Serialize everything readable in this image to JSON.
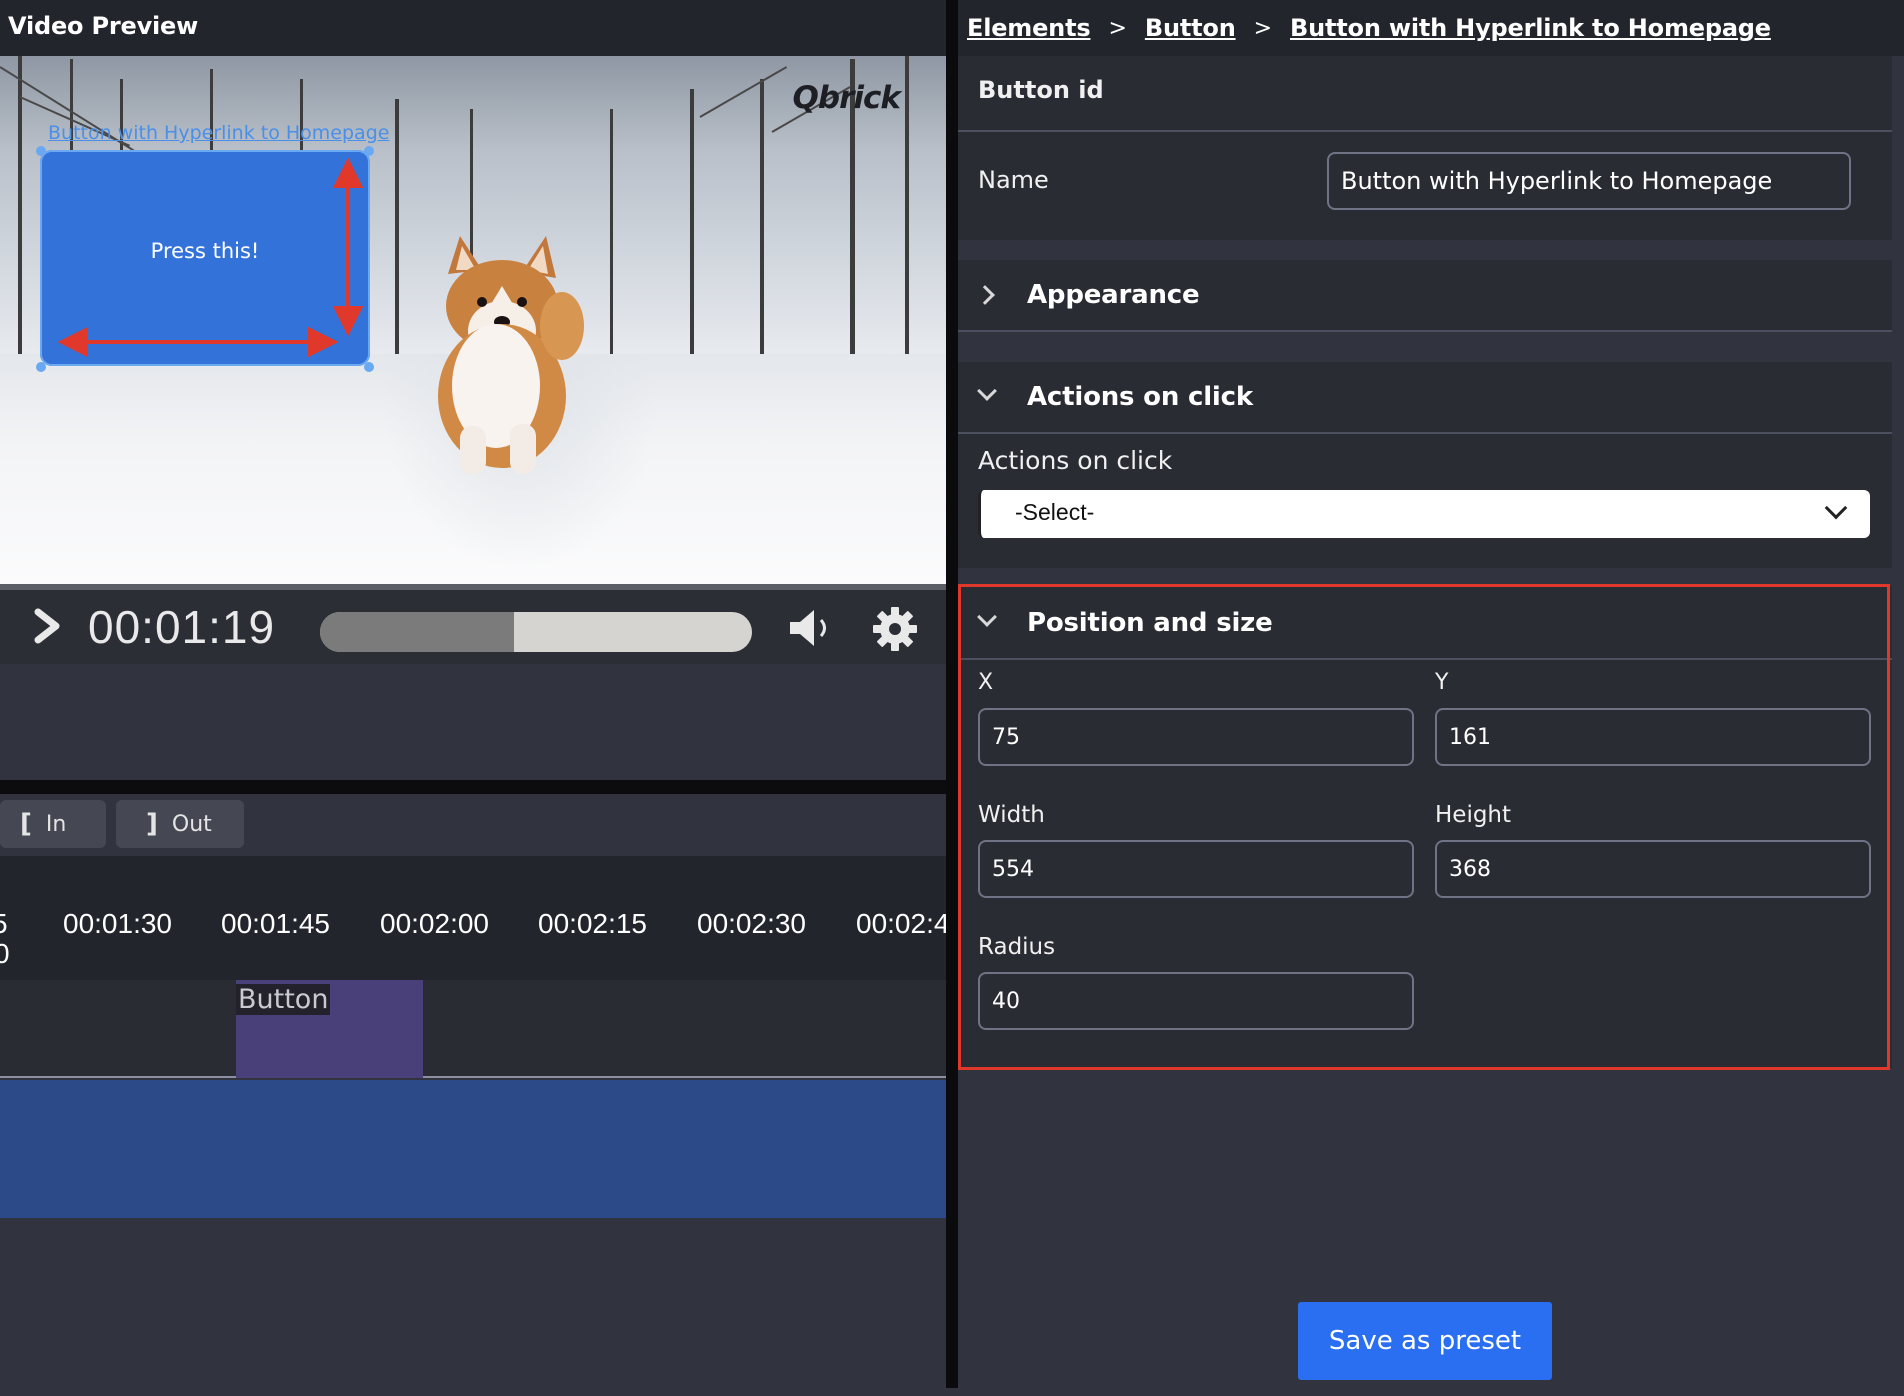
{
  "video_preview": {
    "title": "Video Preview",
    "logo_text": "Qbrick",
    "overlay_button_name": "Button with Hyperlink to Homepage",
    "overlay_button_label": "Press this!"
  },
  "player": {
    "timecode": "00:01:19",
    "progress_fraction": 0.45,
    "play_icon": "play-icon",
    "volume_icon": "volume-icon",
    "settings_icon": "gear-icon"
  },
  "timeline": {
    "in_label": "In",
    "out_label": "Out",
    "in_bracket": "[",
    "out_bracket": "]",
    "ticks": [
      "00:01:30",
      "00:01:45",
      "00:02:00",
      "00:02:15",
      "00:02:30",
      "00:02:4"
    ],
    "clip_label": "Button"
  },
  "breadcrumb": {
    "items": [
      "Elements",
      "Button",
      "Button with Hyperlink to Homepage"
    ],
    "separator": ">"
  },
  "properties": {
    "button_id_label": "Button id",
    "name_label": "Name",
    "name_value": "Button with Hyperlink to Homepage",
    "appearance_title": "Appearance",
    "actions_title": "Actions on click",
    "actions_label": "Actions on click",
    "actions_select_value": "-Select-",
    "position_title": "Position and size",
    "x_label": "X",
    "x_value": "75",
    "y_label": "Y",
    "y_value": "161",
    "width_label": "Width",
    "width_value": "554",
    "height_label": "Height",
    "height_value": "368",
    "radius_label": "Radius",
    "radius_value": "40",
    "save_label": "Save as preset"
  },
  "colors": {
    "accent": "#2a6ef2",
    "highlight": "#e0392b",
    "overlay_button": "#3373d9",
    "clip": "#4a4079",
    "track": "#2d4a88"
  }
}
